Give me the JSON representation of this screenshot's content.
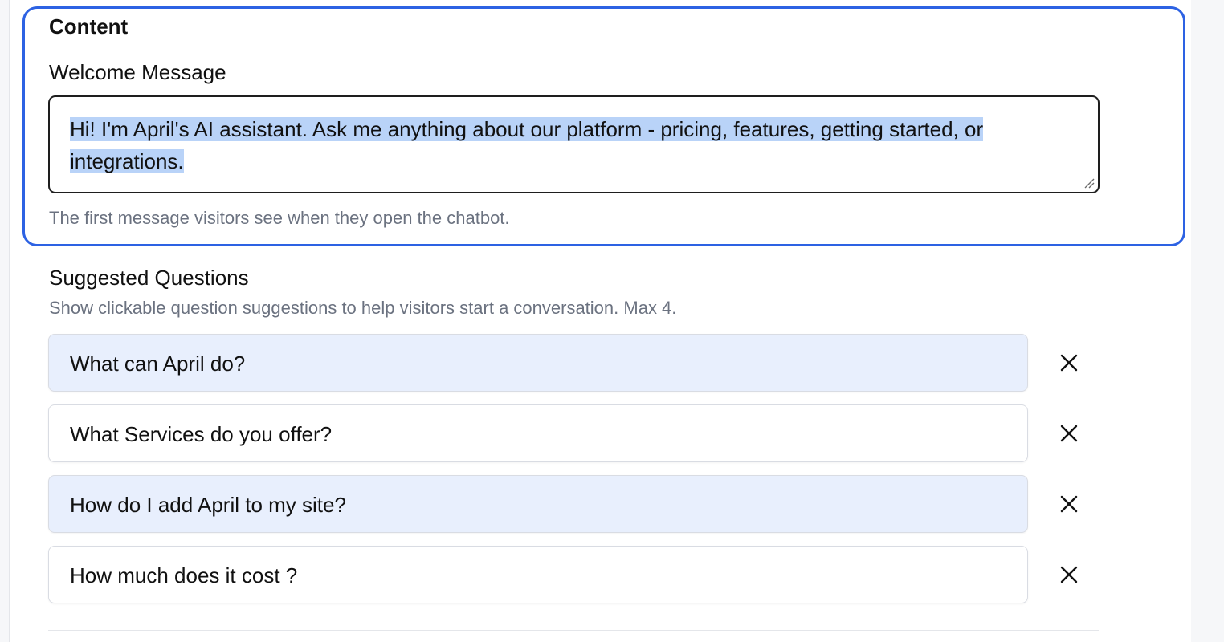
{
  "content": {
    "section_title": "Content",
    "welcome_label": "Welcome Message",
    "welcome_value": "Hi! I'm April's AI assistant. Ask me anything about our platform - pricing, features, getting started, or integrations.",
    "welcome_help": "The first message visitors see when they open the chatbot."
  },
  "suggested": {
    "title": "Suggested Questions",
    "help": "Show clickable question suggestions to help visitors start a conversation. Max 4.",
    "questions": [
      {
        "text": "What can April do?",
        "highlighted": true
      },
      {
        "text": "What Services do you offer?",
        "highlighted": false
      },
      {
        "text": "How do I add April to my site?",
        "highlighted": true
      },
      {
        "text": "How much does it cost ?",
        "highlighted": false
      }
    ],
    "remove_icon": "close-icon"
  },
  "colors": {
    "focus_ring": "#2d62e3",
    "selection": "#b9d3f8",
    "tinted_input": "#e8effd",
    "muted_text": "#6b7280"
  }
}
